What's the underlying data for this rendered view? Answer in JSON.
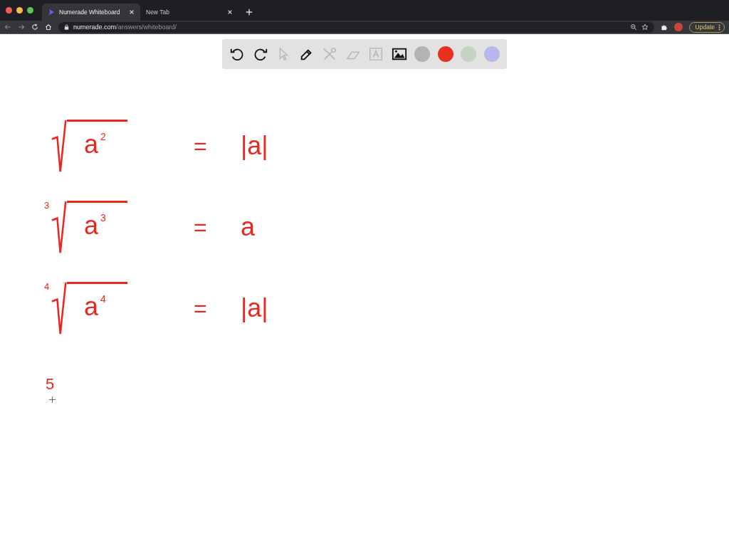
{
  "browser": {
    "tabs": [
      {
        "title": "Numerade Whiteboard",
        "selected": true
      },
      {
        "title": "New Tab",
        "selected": false
      }
    ],
    "address": {
      "domain": "numerade.com",
      "path": "/answers/whiteboard/"
    },
    "update_button": "Update"
  },
  "toolbar": {
    "tools": [
      {
        "kind": "undo",
        "enabled": true
      },
      {
        "kind": "redo",
        "enabled": true
      },
      {
        "kind": "select",
        "enabled": false
      },
      {
        "kind": "pen",
        "enabled": true
      },
      {
        "kind": "tools",
        "enabled": false
      },
      {
        "kind": "eraser",
        "enabled": false
      },
      {
        "kind": "text",
        "enabled": false
      },
      {
        "kind": "image",
        "enabled": true
      }
    ],
    "colors": [
      {
        "color": "#b3b3b3"
      },
      {
        "color": "#e8321f"
      },
      {
        "color": "#c4d3c0"
      },
      {
        "color": "#b7b7ec"
      }
    ]
  },
  "whiteboard": {
    "lines": [
      {
        "kind": "root",
        "radicand": "a",
        "exponent": "2",
        "relation": "=",
        "result": "|a|"
      },
      {
        "kind": "root",
        "index": "3",
        "radicand": "a",
        "exponent": "3",
        "relation": "=",
        "result": "a"
      },
      {
        "kind": "root",
        "index": "4",
        "radicand": "a",
        "exponent": "4",
        "relation": "=",
        "result": "|a|"
      },
      {
        "kind": "text",
        "text": "5"
      }
    ]
  }
}
